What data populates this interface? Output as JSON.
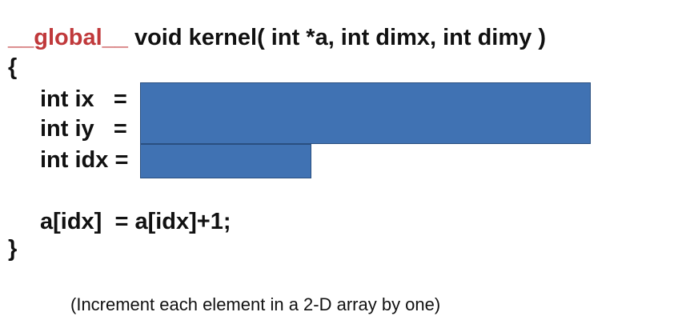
{
  "signature": {
    "qualifier": "__global__",
    "rest": " void kernel( int *a, int dimx, int dimy )"
  },
  "open_brace": "{",
  "lines": {
    "ix": "int ix   =",
    "iy": "int iy   =",
    "idx": "int idx =",
    "assign": "a[idx]  = a[idx]+1;"
  },
  "close_brace": "}",
  "caption": "(Increment each element in a 2-D array by one)",
  "colors": {
    "qualifier": "#c0393b",
    "blank_fill": "#4072b3",
    "blank_border": "#2a4f80"
  }
}
